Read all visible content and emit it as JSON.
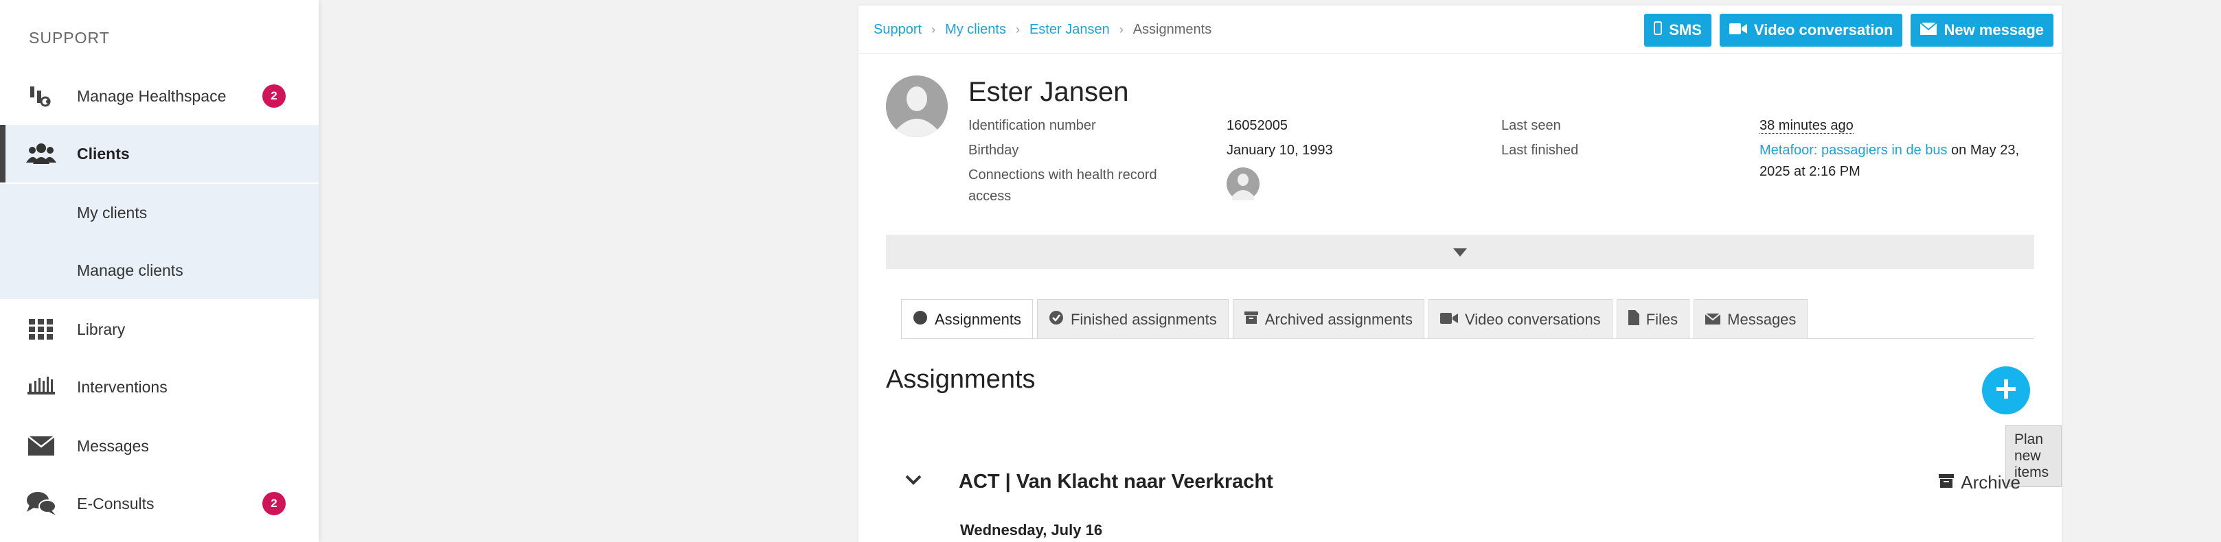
{
  "sidebar": {
    "section_title": "SUPPORT",
    "items": [
      {
        "label": "Manage Healthspace",
        "icon": "healthspace-icon",
        "badge": "2"
      },
      {
        "label": "Clients",
        "icon": "users-icon"
      },
      {
        "label": "My clients"
      },
      {
        "label": "Manage clients"
      },
      {
        "label": "Library",
        "icon": "grid-icon"
      },
      {
        "label": "Interventions",
        "icon": "interventions-icon"
      },
      {
        "label": "Messages",
        "icon": "envelope-icon"
      },
      {
        "label": "E-Consults",
        "icon": "chat-icon",
        "badge": "2"
      }
    ]
  },
  "breadcrumb": [
    "Support",
    "My clients",
    "Ester Jansen",
    "Assignments"
  ],
  "actions": {
    "sms": "SMS",
    "video": "Video conversation",
    "message": "New message"
  },
  "client": {
    "name": "Ester Jansen",
    "id_label": "Identification number",
    "id_value": "16052005",
    "birthday_label": "Birthday",
    "birthday_value": "January 10, 1993",
    "connections_label": "Connections with health record access",
    "last_seen_label": "Last seen",
    "last_seen_value": "38 minutes ago",
    "last_finished_label": "Last finished",
    "last_finished_link": "Metafoor: passagiers in de bus",
    "last_finished_suffix": " on May 23, 2025 at 2:16 PM"
  },
  "tabs": [
    {
      "label": "Assignments",
      "icon": "circle-icon",
      "active": true
    },
    {
      "label": "Finished assignments",
      "icon": "check-circle-icon"
    },
    {
      "label": "Archived assignments",
      "icon": "archive-icon"
    },
    {
      "label": "Video conversations",
      "icon": "video-icon"
    },
    {
      "label": "Files",
      "icon": "file-icon"
    },
    {
      "label": "Messages",
      "icon": "envelope-icon"
    }
  ],
  "main": {
    "heading": "Assignments",
    "plan_tooltip": "Plan new items",
    "group_title": "ACT | Van Klacht naar Veerkracht",
    "archive_label": "Archive",
    "date": "Wednesday, July 16"
  },
  "colors": {
    "accent": "#15a6e0",
    "badge": "#d0145a",
    "sidebar_active_bg": "#e9f0f7"
  }
}
